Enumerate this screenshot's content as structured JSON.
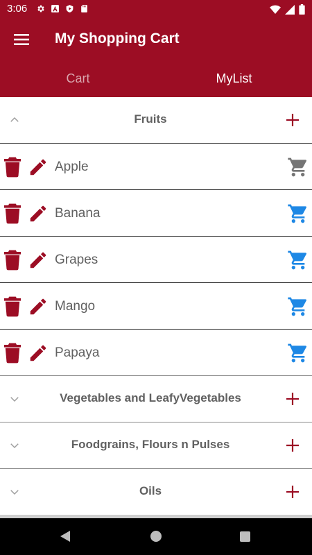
{
  "status_bar": {
    "time": "3:06",
    "left_icons": [
      "gear-icon",
      "a-icon",
      "shield-play-icon",
      "sd-card-icon"
    ],
    "right_icons": [
      "wifi-icon",
      "signal-icon",
      "battery-icon"
    ]
  },
  "app_bar": {
    "title": "My Shopping Cart",
    "menu_icon": "hamburger-menu-icon"
  },
  "tabs": [
    {
      "label": "Cart",
      "active": false
    },
    {
      "label": "MyList",
      "active": true
    }
  ],
  "groups": [
    {
      "title": "Fruits",
      "expanded": true,
      "items": [
        {
          "name": "Apple",
          "in_cart": true,
          "cart_color": "#757575"
        },
        {
          "name": "Banana",
          "in_cart": false,
          "cart_color": "#1e88e5"
        },
        {
          "name": "Grapes",
          "in_cart": false,
          "cart_color": "#1e88e5"
        },
        {
          "name": "Mango",
          "in_cart": false,
          "cart_color": "#1e88e5"
        },
        {
          "name": "Papaya",
          "in_cart": false,
          "cart_color": "#1e88e5"
        }
      ]
    },
    {
      "title": "Vegetables and LeafyVegetables",
      "expanded": false
    },
    {
      "title": "Foodgrains, Flours n Pulses",
      "expanded": false
    },
    {
      "title": "Oils",
      "expanded": false
    }
  ],
  "colors": {
    "primary": "#9c0d24",
    "action_icon": "#9c0d24",
    "text_gray": "#616161",
    "cart_blue": "#1e88e5",
    "cart_gray": "#757575"
  },
  "nav_bar": {
    "buttons": [
      "back-icon",
      "home-icon",
      "recents-icon"
    ]
  }
}
